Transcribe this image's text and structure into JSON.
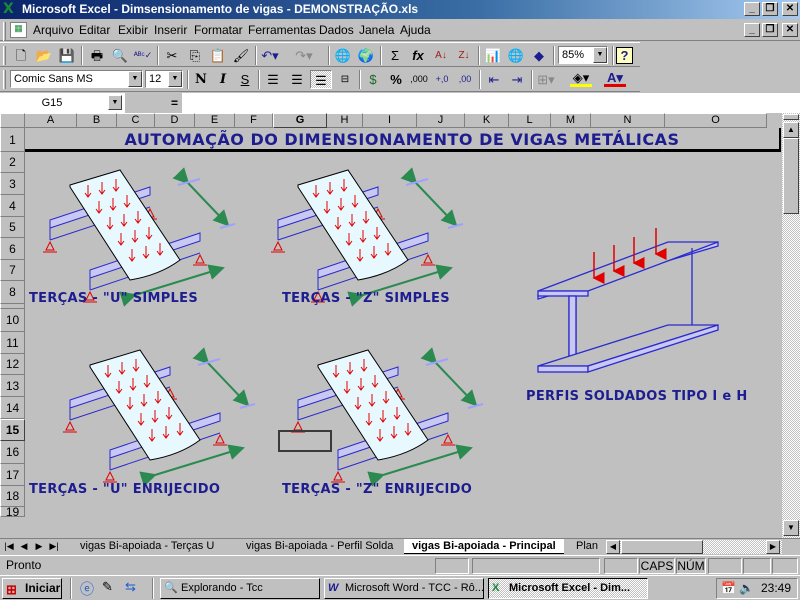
{
  "window": {
    "title": "Microsoft Excel - Dimsensionamento de vigas - DEMONSTRAÇÃO.xls",
    "buttons": [
      "minimize",
      "restore",
      "close"
    ]
  },
  "menubar": {
    "items": [
      {
        "label": "Arquivo",
        "accel": "A"
      },
      {
        "label": "Editar",
        "accel": "E"
      },
      {
        "label": "Exibir",
        "accel": "x"
      },
      {
        "label": "Inserir",
        "accel": "I"
      },
      {
        "label": "Formatar",
        "accel": "F"
      },
      {
        "label": "Ferramentas",
        "accel": "m"
      },
      {
        "label": "Dados",
        "accel": "D"
      },
      {
        "label": "Janela",
        "accel": "J"
      },
      {
        "label": "Ajuda",
        "accel": "u"
      }
    ]
  },
  "standard_toolbar": {
    "icons": [
      "new-icon",
      "open-icon",
      "save-icon",
      "print-icon",
      "print-preview-icon",
      "spelling-icon",
      "cut-icon",
      "copy-icon",
      "paste-icon",
      "format-painter-icon",
      "undo-icon",
      "redo-icon",
      "hyperlink-icon",
      "web-toolbar-icon",
      "autosum-icon",
      "function-icon",
      "sort-ascending-icon",
      "sort-descending-icon",
      "chart-wizard-icon",
      "map-icon",
      "drawing-icon",
      "help-icon"
    ],
    "zoom": "85%"
  },
  "format_toolbar": {
    "font": "Comic Sans MS",
    "size": "12",
    "bold": "N",
    "italic": "I",
    "underline": "S",
    "percent": "%",
    "thousands": ",000"
  },
  "formula_bar": {
    "name_box": "G15",
    "equals": "=",
    "value": ""
  },
  "sheet": {
    "columns": [
      "A",
      "B",
      "C",
      "D",
      "E",
      "F",
      "G",
      "H",
      "I",
      "J",
      "K",
      "L",
      "M",
      "N",
      "O"
    ],
    "selected_column": "G",
    "rows": [
      "1",
      "2",
      "3",
      "4",
      "5",
      "6",
      "7",
      "8",
      "10",
      "11",
      "12",
      "13",
      "14",
      "15",
      "16",
      "17",
      "18",
      "19"
    ],
    "selected_row": "15",
    "banner": "AUTOMAÇÃO DO DIMENSIONAMENTO DE VIGAS METÁLICAS",
    "labels": {
      "u_simples": "TERÇAS - \"U\" SIMPLES",
      "z_simples": "TERÇAS - \"Z\" SIMPLES",
      "u_enrijecido": "TERÇAS - \"U\" ENRIJECIDO",
      "z_enrijecido": "TERÇAS - \"Z\" ENRIJECIDO",
      "perfis": "PERFIS SOLDADOS TIPO I e H"
    },
    "colors": {
      "text": "#1d1d8f",
      "beam": "#2a2ad0",
      "load": "#e00000",
      "dimension": "#2a8a50"
    }
  },
  "tabs": {
    "items": [
      {
        "label": "vigas Bi-apoiada - Terças U",
        "active": false
      },
      {
        "label": "vigas Bi-apoiada - Perfil Solda",
        "active": false
      },
      {
        "label": "vigas Bi-apoiada - Principal",
        "active": true
      },
      {
        "label": "Plan",
        "active": false
      }
    ]
  },
  "statusbar": {
    "status": "Pronto",
    "caps": "CAPS",
    "num": "NÚM"
  },
  "taskbar": {
    "start": "Iniciar",
    "tasks": [
      {
        "label": "Explorando - Tcc",
        "active": false
      },
      {
        "label": "Microsoft Word - TCC - Rô...",
        "active": false
      },
      {
        "label": "Microsoft Excel - Dim...",
        "active": true
      }
    ],
    "clock": "23:49"
  }
}
